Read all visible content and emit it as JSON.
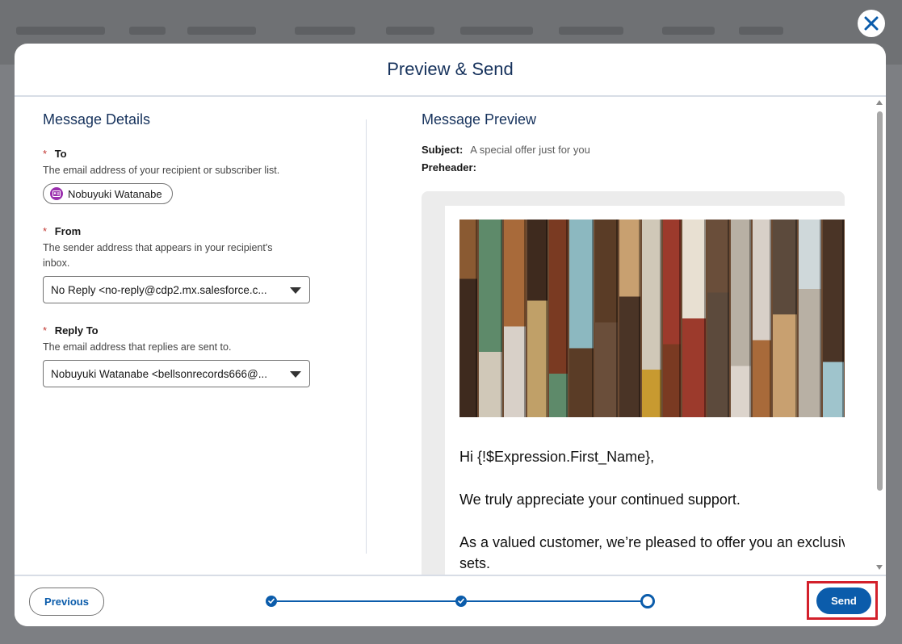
{
  "modal": {
    "title": "Preview & Send",
    "close_icon": "close-icon"
  },
  "details": {
    "section_title": "Message Details",
    "to": {
      "label": "To",
      "help": "The email address of your recipient or subscriber list.",
      "recipient": "Nobuyuki Watanabe",
      "recipient_icon": "contact-card-icon"
    },
    "from": {
      "label": "From",
      "help": "The sender address that appears in your recipient's inbox.",
      "value": "No Reply <no-reply@cdp2.mx.salesforce.c..."
    },
    "reply_to": {
      "label": "Reply To",
      "help": "The email address that replies are sent to.",
      "value": "Nobuyuki Watanabe <bellsonrecords666@..."
    },
    "required_marker": "*"
  },
  "preview": {
    "section_title": "Message Preview",
    "subject_label": "Subject:",
    "subject_value": "A special offer just for you",
    "preheader_label": "Preheader:",
    "preheader_value": "",
    "email": {
      "greeting": "Hi {!$Expression.First_Name},",
      "line1": "We truly appreciate your continued support.",
      "line2": "As a valued customer, we’re pleased to offer you an exclusive RBA sets."
    }
  },
  "footer": {
    "previous_label": "Previous",
    "send_label": "Send",
    "progress": {
      "steps_total": 3,
      "steps_completed": 2,
      "current_step": 3
    }
  },
  "colors": {
    "brand": "#0b5cab",
    "title": "#16325c",
    "required": "#c23934",
    "highlight": "#d3202b"
  }
}
